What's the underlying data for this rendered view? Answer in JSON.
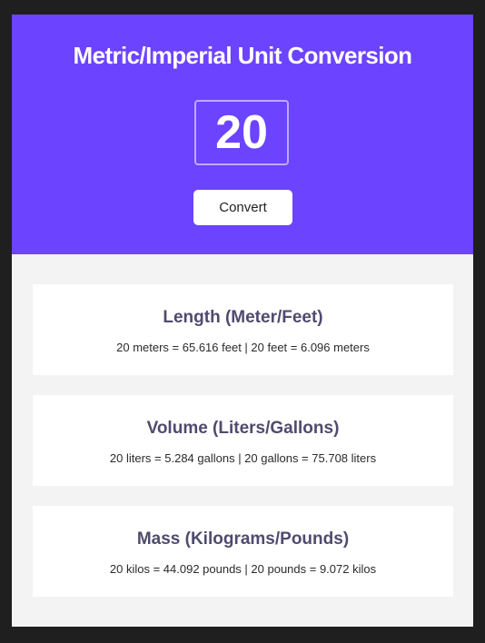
{
  "header": {
    "title": "Metric/Imperial Unit Conversion",
    "input_value": "20",
    "convert_label": "Convert"
  },
  "results": [
    {
      "title": "Length (Meter/Feet)",
      "text": "20 meters = 65.616 feet | 20 feet = 6.096 meters"
    },
    {
      "title": "Volume (Liters/Gallons)",
      "text": "20 liters = 5.284 gallons | 20 gallons = 75.708 liters"
    },
    {
      "title": "Mass (Kilograms/Pounds)",
      "text": "20 kilos = 44.092 pounds | 20 pounds = 9.072 kilos"
    }
  ],
  "colors": {
    "accent": "#6c43ff",
    "background": "#f3f3f3",
    "panel_title": "#4f4b6e"
  }
}
